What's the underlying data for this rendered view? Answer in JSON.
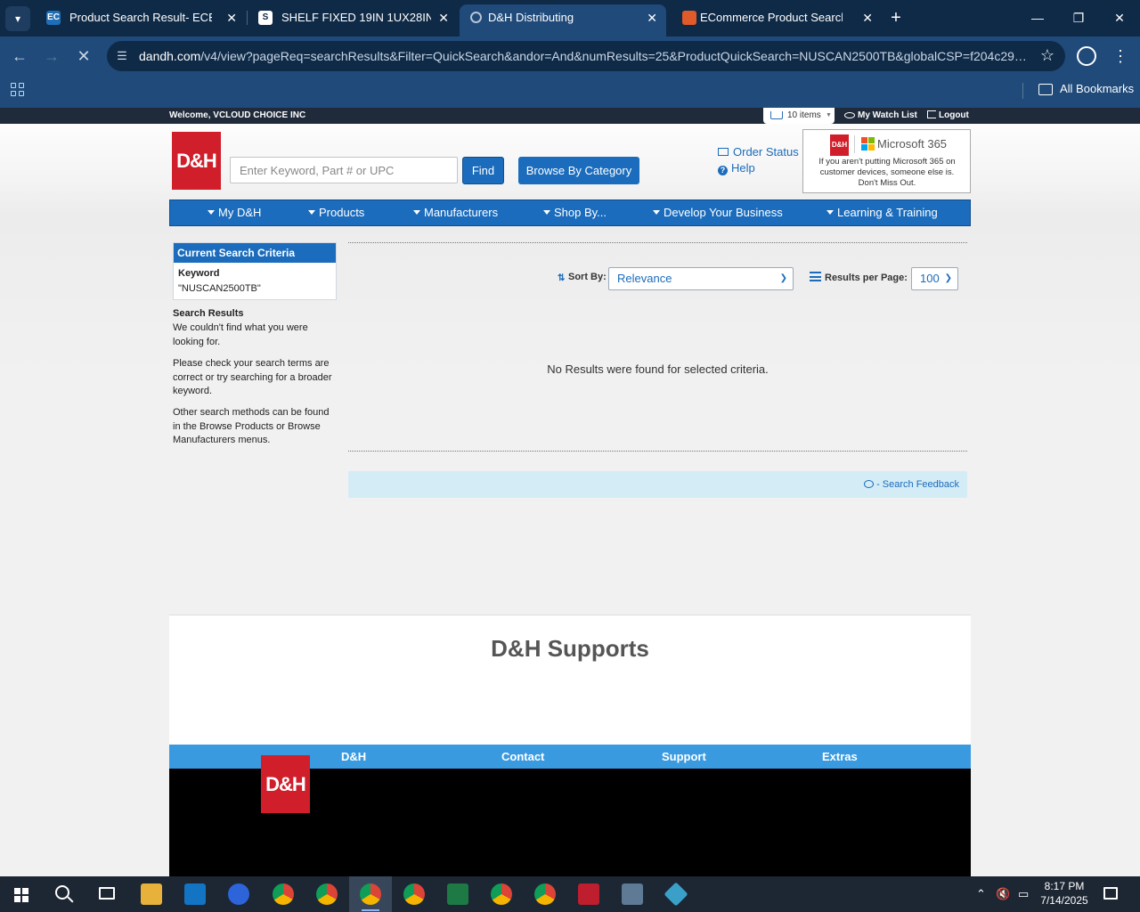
{
  "browser": {
    "tabs": [
      {
        "label": "Product Search Result- ECExpre",
        "favicon": "EC",
        "active": false
      },
      {
        "label": "SHELF FIXED 19IN 1UX28IN 200",
        "favicon": "S",
        "active": false
      },
      {
        "label": "D&H Distributing",
        "favicon": "",
        "active": true
      },
      {
        "label": "ECommerce Product Search",
        "favicon": "",
        "active": false
      }
    ],
    "url_host": "dandh.com",
    "url_path": "/v4/view?pageReq=searchResults&Filter=QuickSearch&andor=And&numResults=25&ProductQuickSearch=NUSCAN2500TB&globalCSP=f204c29a-...",
    "bookmarks_label": "All Bookmarks"
  },
  "page": {
    "welcome": "Welcome, VCLOUD CHOICE INC",
    "cart_label": "10 items",
    "watch_list": "My Watch List",
    "logout": "Logout",
    "logo_text": "D&H",
    "search_placeholder": "Enter Keyword, Part # or UPC",
    "find_label": "Find",
    "browse_label": "Browse By Category",
    "order_status": "Order Status",
    "help": "Help",
    "ad": {
      "badge": "D&H",
      "brand": "Microsoft 365",
      "text": "If you aren't putting Microsoft 365 on customer devices, someone else is. Don't Miss Out."
    },
    "nav": [
      "My D&H",
      "Products",
      "Manufacturers",
      "Shop By...",
      "Develop Your Business",
      "Learning & Training"
    ],
    "criteria": {
      "heading": "Current Search Criteria",
      "label": "Keyword",
      "value": "\"NUSCAN2500TB\""
    },
    "sidebar": {
      "heading": "Search Results",
      "p1": "We couldn't find what you were looking for.",
      "p2": "Please check your search terms are correct or try searching for a broader keyword.",
      "p3": "Other search methods can be found in the Browse Products or Browse Manufacturers menus."
    },
    "sort_label": "Sort By:",
    "sort_value": "Relevance",
    "rpp_label": "Results per Page:",
    "rpp_value": "100",
    "no_results": "No Results were found for selected criteria.",
    "feedback": "- Search Feedback",
    "supports_title": "D&H Supports",
    "footer_links": [
      "D&H",
      "Contact",
      "Support",
      "Extras"
    ]
  },
  "taskbar": {
    "time": "8:17 PM",
    "date": "7/14/2025"
  },
  "colors": {
    "brand_blue": "#1b6cbc",
    "brand_red": "#d01e2a",
    "chrome_dark": "#0f2a47",
    "chrome_light": "#1f4a7a"
  }
}
